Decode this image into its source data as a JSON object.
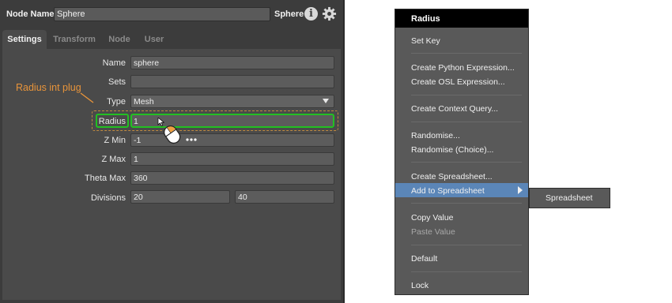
{
  "header": {
    "node_name_label": "Node Name",
    "node_name_value": "Sphere",
    "node_type": "Sphere",
    "info_icon": "info-icon",
    "gear_icon": "gear-icon"
  },
  "tabs": [
    {
      "label": "Settings",
      "active": true
    },
    {
      "label": "Transform",
      "active": false
    },
    {
      "label": "Node",
      "active": false
    },
    {
      "label": "User",
      "active": false
    }
  ],
  "plugs": {
    "name": {
      "label": "Name",
      "value": "sphere"
    },
    "sets": {
      "label": "Sets",
      "value": ""
    },
    "type": {
      "label": "Type",
      "value": "Mesh"
    },
    "radius": {
      "label": "Radius",
      "value": "1"
    },
    "zmin": {
      "label": "Z Min",
      "value": "-1"
    },
    "zmax": {
      "label": "Z Max",
      "value": "1"
    },
    "thetamax": {
      "label": "Theta Max",
      "value": "360"
    },
    "divisions": {
      "label": "Divisions",
      "value_a": "20",
      "value_b": "40"
    }
  },
  "annotation": {
    "text": "Radius int plug",
    "color": "#e8943a",
    "highlight_color": "#22c022"
  },
  "context_menu": {
    "title": "Radius",
    "items": [
      "Set Key",
      "Create Python Expression...",
      "Create OSL Expression...",
      "Create Context Query...",
      "Randomise...",
      "Randomise (Choice)...",
      "Create Spreadsheet...",
      "Add to Spreadsheet",
      "Copy Value",
      "Paste Value",
      "Default",
      "Lock"
    ],
    "highlighted": "Add to Spreadsheet",
    "disabled": [
      "Paste Value"
    ],
    "highlight_color": "#5b86b8"
  },
  "submenu": {
    "items": [
      "Spreadsheet"
    ]
  }
}
